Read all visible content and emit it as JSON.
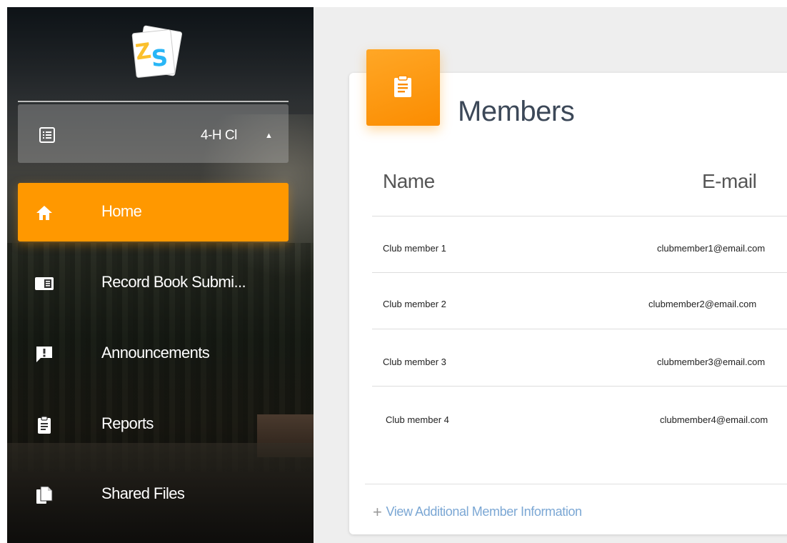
{
  "app": {
    "logo_text": "ZS"
  },
  "club_selector": {
    "label": "4-H Cl",
    "caret_icon": "caret-up-icon",
    "icon": "list-icon"
  },
  "sidebar": {
    "items": [
      {
        "label": "Home",
        "icon": "home-icon",
        "active": true
      },
      {
        "label": "Record Book Submi...",
        "icon": "record-book-icon",
        "active": false
      },
      {
        "label": "Announcements",
        "icon": "announcement-icon",
        "active": false
      },
      {
        "label": "Reports",
        "icon": "clipboard-icon",
        "active": false
      },
      {
        "label": "Shared Files",
        "icon": "files-icon",
        "active": false
      }
    ]
  },
  "members": {
    "title": "Members",
    "columns": [
      "Name",
      "E-mail"
    ],
    "rows": [
      {
        "name": "Club member 1",
        "email": "clubmember1@email.com"
      },
      {
        "name": "Club member 2",
        "email": "clubmember2@email.com"
      },
      {
        "name": "Club member 3",
        "email": "clubmember3@email.com"
      },
      {
        "name": "Club member 4",
        "email": "clubmember4@email.com"
      }
    ],
    "more_link": "View Additional Member Information"
  },
  "colors": {
    "accent": "#ff9800",
    "link": "#7ba7d4",
    "title": "#3c4858"
  }
}
